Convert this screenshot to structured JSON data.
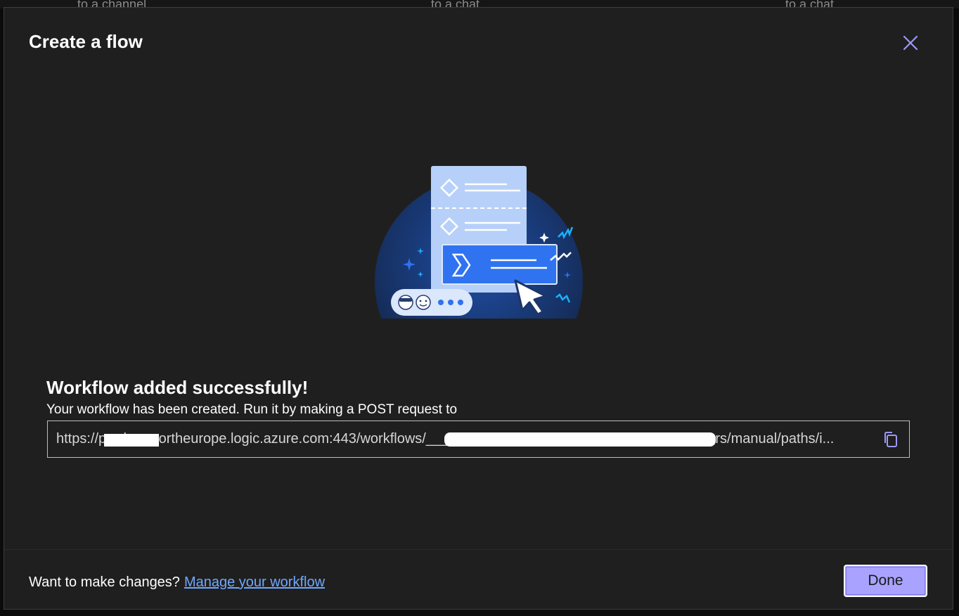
{
  "background": {
    "fragments": [
      "to a channel",
      "to a chat",
      "to a chat"
    ]
  },
  "dialog": {
    "title": "Create a flow",
    "close_icon": "close-icon"
  },
  "success": {
    "title": "Workflow added successfully!",
    "description": "Your workflow has been created. Run it by making a POST request to",
    "url_display": "https://prod-__.northeurope.logic.azure.com:443/workflows/________________________________/triggers/manual/paths/i...",
    "copy_icon": "copy-icon"
  },
  "footer": {
    "prompt": "Want to make changes?",
    "link": "Manage your workflow",
    "done": "Done"
  },
  "colors": {
    "dialog_bg": "#1f1f1f",
    "link": "#6fa8ff",
    "primary_button": "#a9a3ff",
    "close_icon": "#9d97ff",
    "illustration_blue": "#2f73f1"
  }
}
